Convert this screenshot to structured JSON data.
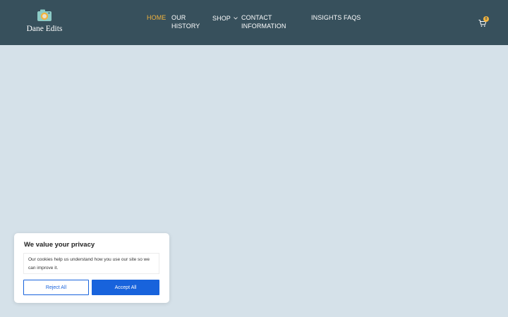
{
  "brand": {
    "name": "Dane Edits"
  },
  "nav": {
    "home": "HOME",
    "history": "OUR HISTORY",
    "shop": "SHOP",
    "contact": "CONTACT INFORMATION",
    "insights": "INSIGHTS",
    "faqs": "FAQS"
  },
  "cart": {
    "count": "0"
  },
  "cookie": {
    "title": "We value your privacy",
    "text": "Our cookies help us understand how you use our site so we can improve it.",
    "reject": "Reject All",
    "accept": "Accept All"
  },
  "colors": {
    "header": "#37505c",
    "page": "#d5e1e9",
    "accent": "#f2b33d",
    "button": "#1863dc"
  },
  "icons": [
    "camera-logo-icon",
    "chevron-down-icon",
    "cart-icon"
  ]
}
